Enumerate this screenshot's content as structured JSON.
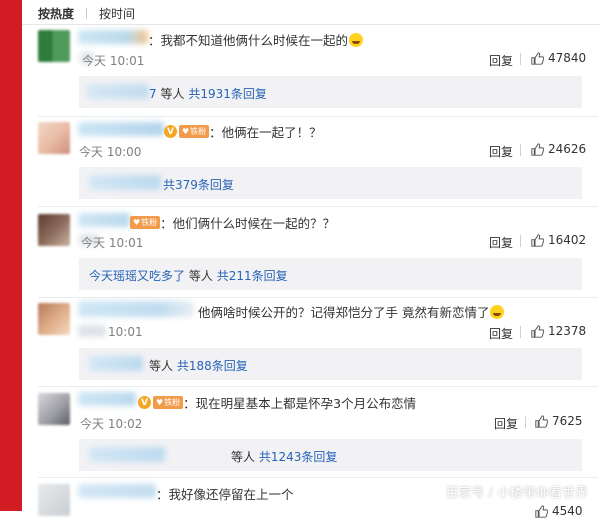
{
  "sort_tabs": {
    "hot": "按热度",
    "time": "按时间"
  },
  "comments": [
    {
      "text": "：我都不知道他俩什么时候在一起的",
      "time": "今天 10:01",
      "reply": "回复",
      "likes": "47840",
      "sub_tail": "7",
      "sub_wait": "等人",
      "sub_link": "共1931条回复"
    },
    {
      "text": "：他俩在一起了！？",
      "time": "今天 10:00",
      "reply": "回复",
      "likes": "24626",
      "sub_wait": "",
      "sub_link": "共379条回复",
      "badge": "铁粉"
    },
    {
      "text": "：他们俩什么时候在一起的？？",
      "time": "今天 10:01",
      "reply": "回复",
      "likes": "16402",
      "sub_user": "今天瑶瑶又吃多了",
      "sub_wait": "等人",
      "sub_link": "共211条回复",
      "badge": "铁粉"
    },
    {
      "text": "他俩啥时候公开的？记得郑恺分了手 竟然有新恋情了",
      "time": "10:01",
      "reply": "回复",
      "likes": "12378",
      "sub_wait": "等人",
      "sub_link": "共188条回复"
    },
    {
      "text": "：现在明星基本上都是怀孕3个月公布恋情",
      "time": "今天 10:02",
      "reply": "回复",
      "likes": "7625",
      "sub_wait": "等人",
      "sub_link": "共1243条回复",
      "badge": "铁粉"
    },
    {
      "text": "：我好像还停留在上一个",
      "time": "",
      "reply": "",
      "likes": "4540"
    }
  ],
  "watermark": "百家号 / 小楼带你看世界",
  "colors": {
    "link": "#2763b8",
    "stripe": "#d01c22",
    "sub_bg": "#f2f2f5"
  }
}
